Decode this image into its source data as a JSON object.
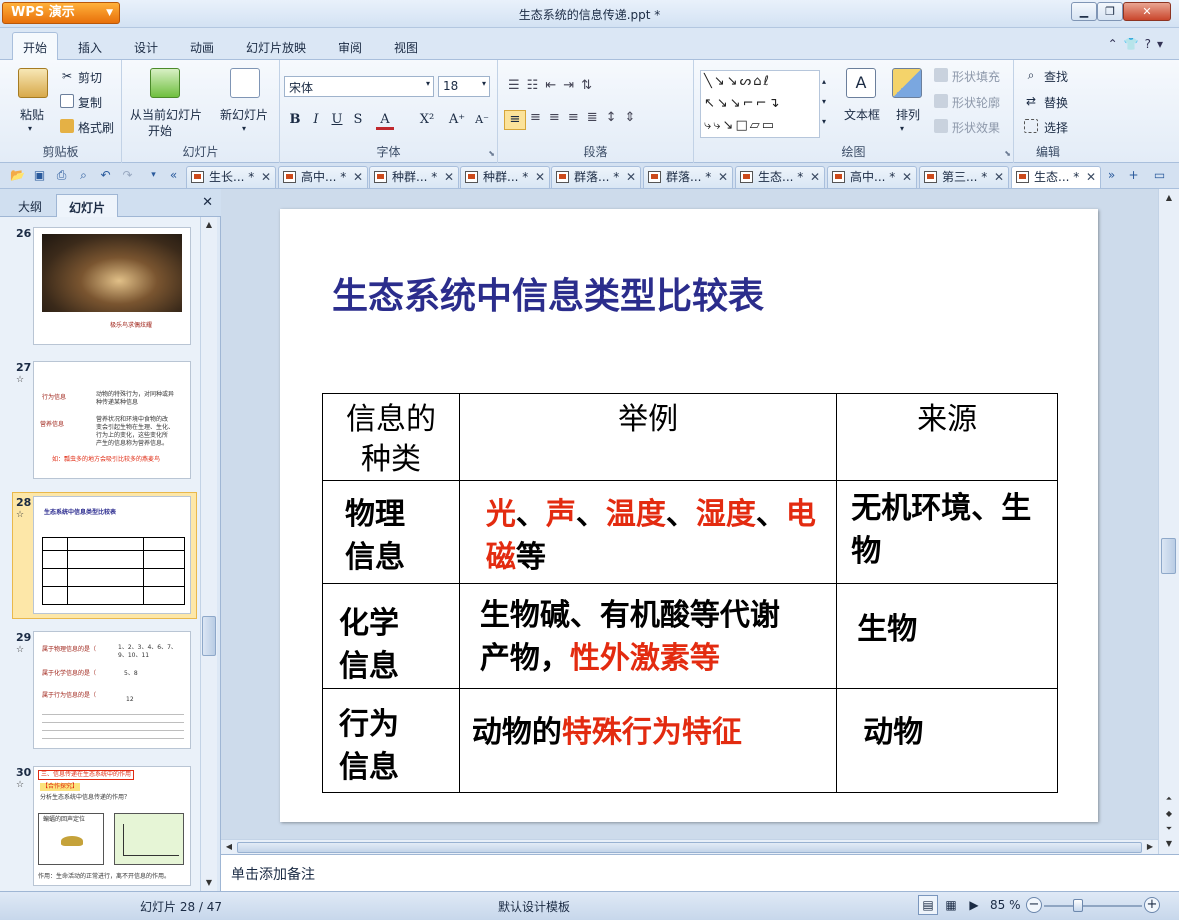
{
  "app": {
    "logo_label": "WPS 演示",
    "document_title": "生态系统的信息传递.ppt *"
  },
  "menu": {
    "tabs": [
      "开始",
      "插入",
      "设计",
      "动画",
      "幻灯片放映",
      "审阅",
      "视图"
    ],
    "active_tab": "开始"
  },
  "ribbon": {
    "clipboard": {
      "group": "剪贴板",
      "paste": "粘贴",
      "cut": "剪切",
      "copy": "复制",
      "format_painter": "格式刷"
    },
    "slideshow": {
      "group": "幻灯片",
      "from_current_line1": "从当前幻灯片",
      "from_current_line2": "开始",
      "new_slide": "新幻灯片"
    },
    "font": {
      "group": "字体",
      "font_name": "宋体",
      "font_size": "18",
      "bold": "B",
      "italic": "I",
      "underline": "U",
      "shadow": "S",
      "color_letter": "A"
    },
    "paragraph": {
      "group": "段落"
    },
    "drawing": {
      "group": "绘图",
      "text_box": "文本框",
      "arrange": "排列",
      "shape_fill": "形状填充",
      "shape_outline": "形状轮廓",
      "shape_effect": "形状效果"
    },
    "editing": {
      "group": "编辑",
      "find": "查找",
      "replace": "替换",
      "select": "选择"
    }
  },
  "doc_tabs": [
    {
      "label": "生长... *"
    },
    {
      "label": "高中... *"
    },
    {
      "label": "种群... *"
    },
    {
      "label": "种群... *"
    },
    {
      "label": "群落... *"
    },
    {
      "label": "群落... *"
    },
    {
      "label": "生态... *"
    },
    {
      "label": "高中... *"
    },
    {
      "label": "第三... *"
    },
    {
      "label": "生态... *",
      "active": true
    }
  ],
  "left_panel": {
    "tabs": [
      "大纲",
      "幻灯片"
    ],
    "active_tab": "幻灯片",
    "thumbnails": [
      {
        "number": "26",
        "caption": "极乐鸟求偶炫耀"
      },
      {
        "number": "27",
        "lines": [
          "行为信息",
          "动物的特殊行为，对同种或异",
          "种传递某种信息",
          "营养信息",
          "营养状况和环境中食物的改",
          "变会引起生物在生理、生化、",
          "行为上的变化，这些变化所",
          "产生的信息称为营养信息。",
          "如：瓢虫多的地方会吸引比较多的燕麦鸟"
        ]
      },
      {
        "number": "28",
        "title": "生态系统中信息类型比较表"
      },
      {
        "number": "29",
        "lines": [
          "属于物理信息的是（",
          "1、2、3、4、6、7、",
          "9、10、11",
          "属于化学信息的是（",
          "5、8",
          "属于行为信息的是（",
          "12"
        ]
      },
      {
        "number": "30",
        "lines": [
          "三、信息传递在生态系统中的作用",
          "【合作探究】",
          "分析生态系统中信息传递的作用？",
          "蝙蝠的回声定位",
          "作用：生命活动的正常进行，离不开信息的作用。"
        ]
      }
    ]
  },
  "slide": {
    "title": "生态系统中信息类型比较表",
    "table": {
      "headers": [
        "信息的种类",
        "举例",
        "来源"
      ],
      "rows": [
        {
          "type_line1": "物理",
          "type_line2": "信息",
          "source": "无机环境、生物"
        },
        {
          "type_line1": "化学",
          "type_line2": "信息",
          "source": "生物"
        },
        {
          "type_line1": "行为",
          "type_line2": "信息",
          "source": "动物"
        }
      ],
      "physical_example": {
        "guang": "光",
        "sep1": "、",
        "sheng": "声",
        "sep2": "、",
        "wendu": "温度",
        "sep3": "、",
        "shidu": "湿度",
        "sep4": "、",
        "dianci": "电磁",
        "tail": "等"
      },
      "chemical_example": {
        "part1": "生物碱、有机酸等代谢产物，",
        "part2": "性外激素等"
      },
      "behavior_example": {
        "part1": "动物的",
        "part2": "特殊行为特征"
      }
    }
  },
  "notes_placeholder": "单击添加备注",
  "status": {
    "slide_counter": "幻灯片 28 / 47",
    "template": "默认设计模板",
    "zoom": "85 %",
    "zoom_fraction": 0.35
  }
}
